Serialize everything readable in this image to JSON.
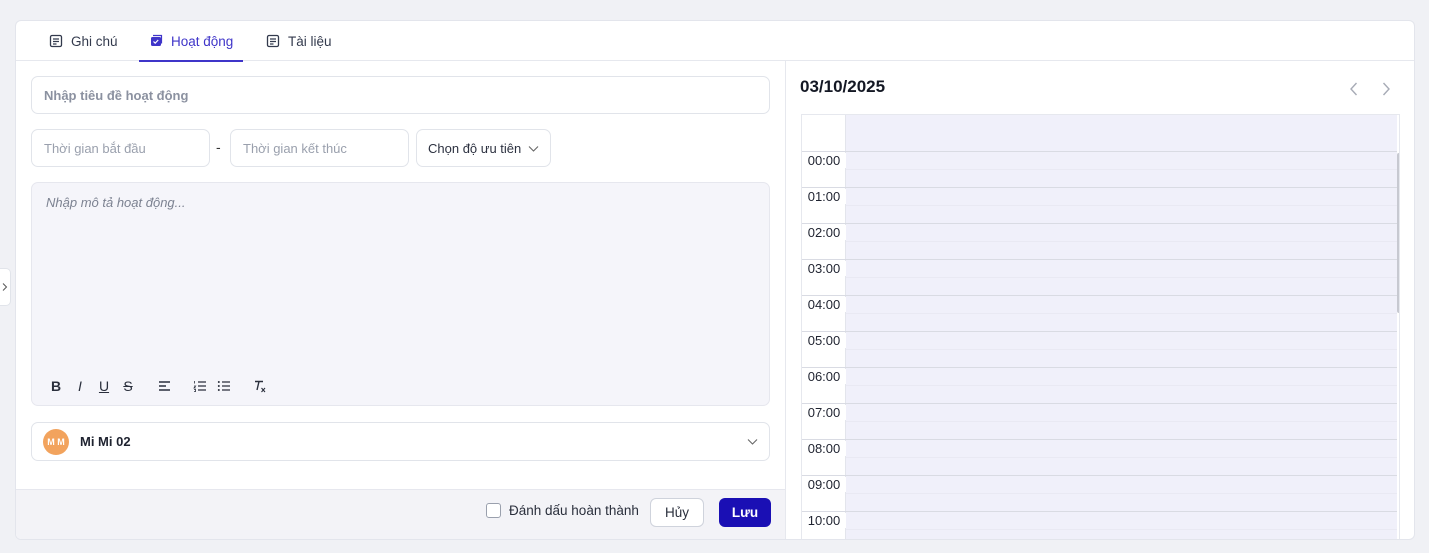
{
  "tabs": [
    {
      "label": "Ghi chú",
      "icon": "note-icon",
      "active": false
    },
    {
      "label": "Hoạt động",
      "icon": "activity-icon",
      "active": true
    },
    {
      "label": "Tài liệu",
      "icon": "document-icon",
      "active": false
    }
  ],
  "form": {
    "title_placeholder": "Nhập tiêu đề hoạt động",
    "start_placeholder": "Thời gian bắt đầu",
    "separator": "-",
    "end_placeholder": "Thời gian kết thúc",
    "priority_label": "Chọn độ ưu tiên",
    "description_placeholder": "Nhập mô tả hoạt động...",
    "toolbar": [
      "B",
      "I",
      "U",
      "S",
      "align-left",
      "ordered-list",
      "bullet-list",
      "clear-format"
    ],
    "assignee": {
      "initials": "M M",
      "name": "Mi Mi 02",
      "avatar_color": "#f2a35d"
    }
  },
  "footer": {
    "complete_label": "Đánh dấu hoàn thành",
    "cancel_label": "Hủy",
    "save_label": "Lưu"
  },
  "calendar": {
    "date": "03/10/2025",
    "hours": [
      "00:00",
      "01:00",
      "02:00",
      "03:00",
      "04:00",
      "05:00",
      "06:00",
      "07:00",
      "08:00",
      "09:00",
      "10:00"
    ]
  },
  "colors": {
    "accent": "#3f35c9",
    "primary_button": "#1a0fb4",
    "calendar_bg": "#f0f0fa"
  }
}
